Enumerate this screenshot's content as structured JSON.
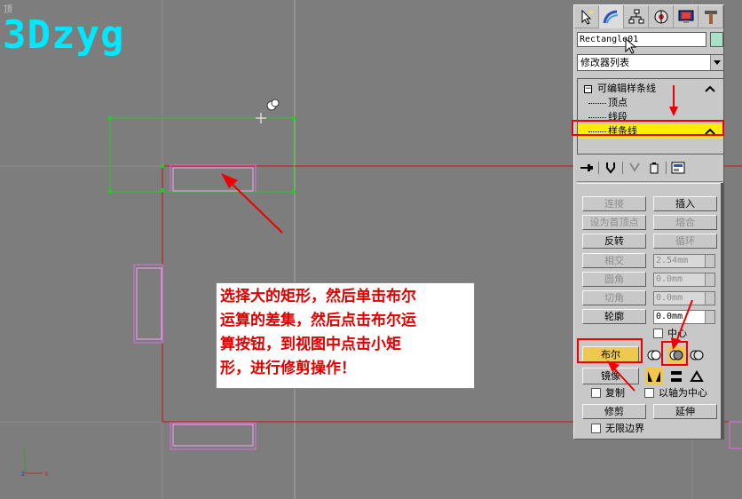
{
  "viewport": {
    "label": "顶",
    "watermark": "3Dzyg",
    "axis_x": "x",
    "axis_y": "y",
    "axis_z": "z"
  },
  "annotation": {
    "line1": "选择大的矩形，然后单击布尔",
    "line2": "运算的差集，然后点击布尔运",
    "line3": "算按钮，到视图中点击小矩",
    "line4": "形，进行修剪操作！"
  },
  "panel": {
    "tabs": [
      "create-icon",
      "modify-icon",
      "hierarchy-icon",
      "motion-icon",
      "display-icon",
      "utilities-icon"
    ],
    "object_name": "Rectangle01",
    "object_color": "#a8e0c8",
    "modifier_list": "修改器列表",
    "stack": {
      "root": "可编辑样条线",
      "vertex": "顶点",
      "segment": "线段",
      "spline": "样条线"
    },
    "geometry": {
      "connect": "连接",
      "insert": "插入",
      "make_first": "设为首顶点",
      "fuse": "熔合",
      "reverse": "反转",
      "cycle": "循环",
      "cross_insert": "相交",
      "cross_value": "2.54mm",
      "fillet": "圆角",
      "fillet_value": "0.0mm",
      "chamfer": "切角",
      "chamfer_value": "0.0mm",
      "outline": "轮廓",
      "outline_value": "0.0mm",
      "center": "中心",
      "boolean": "布尔",
      "mirror": "镜像",
      "copy": "复制",
      "about_pivot": "以轴为中心",
      "trim": "修剪",
      "extend": "延伸",
      "infinite_bounds": "无限边界"
    }
  },
  "colors": {
    "highlight_red": "#ee0000",
    "selected_yellow": "#ffee00",
    "boolean_yellow": "#f0c850",
    "watermark_cyan": "#00e8ff",
    "spline_green": "#22cc22",
    "spline_red": "#cc1111",
    "spline_pink": "#e070e0"
  }
}
